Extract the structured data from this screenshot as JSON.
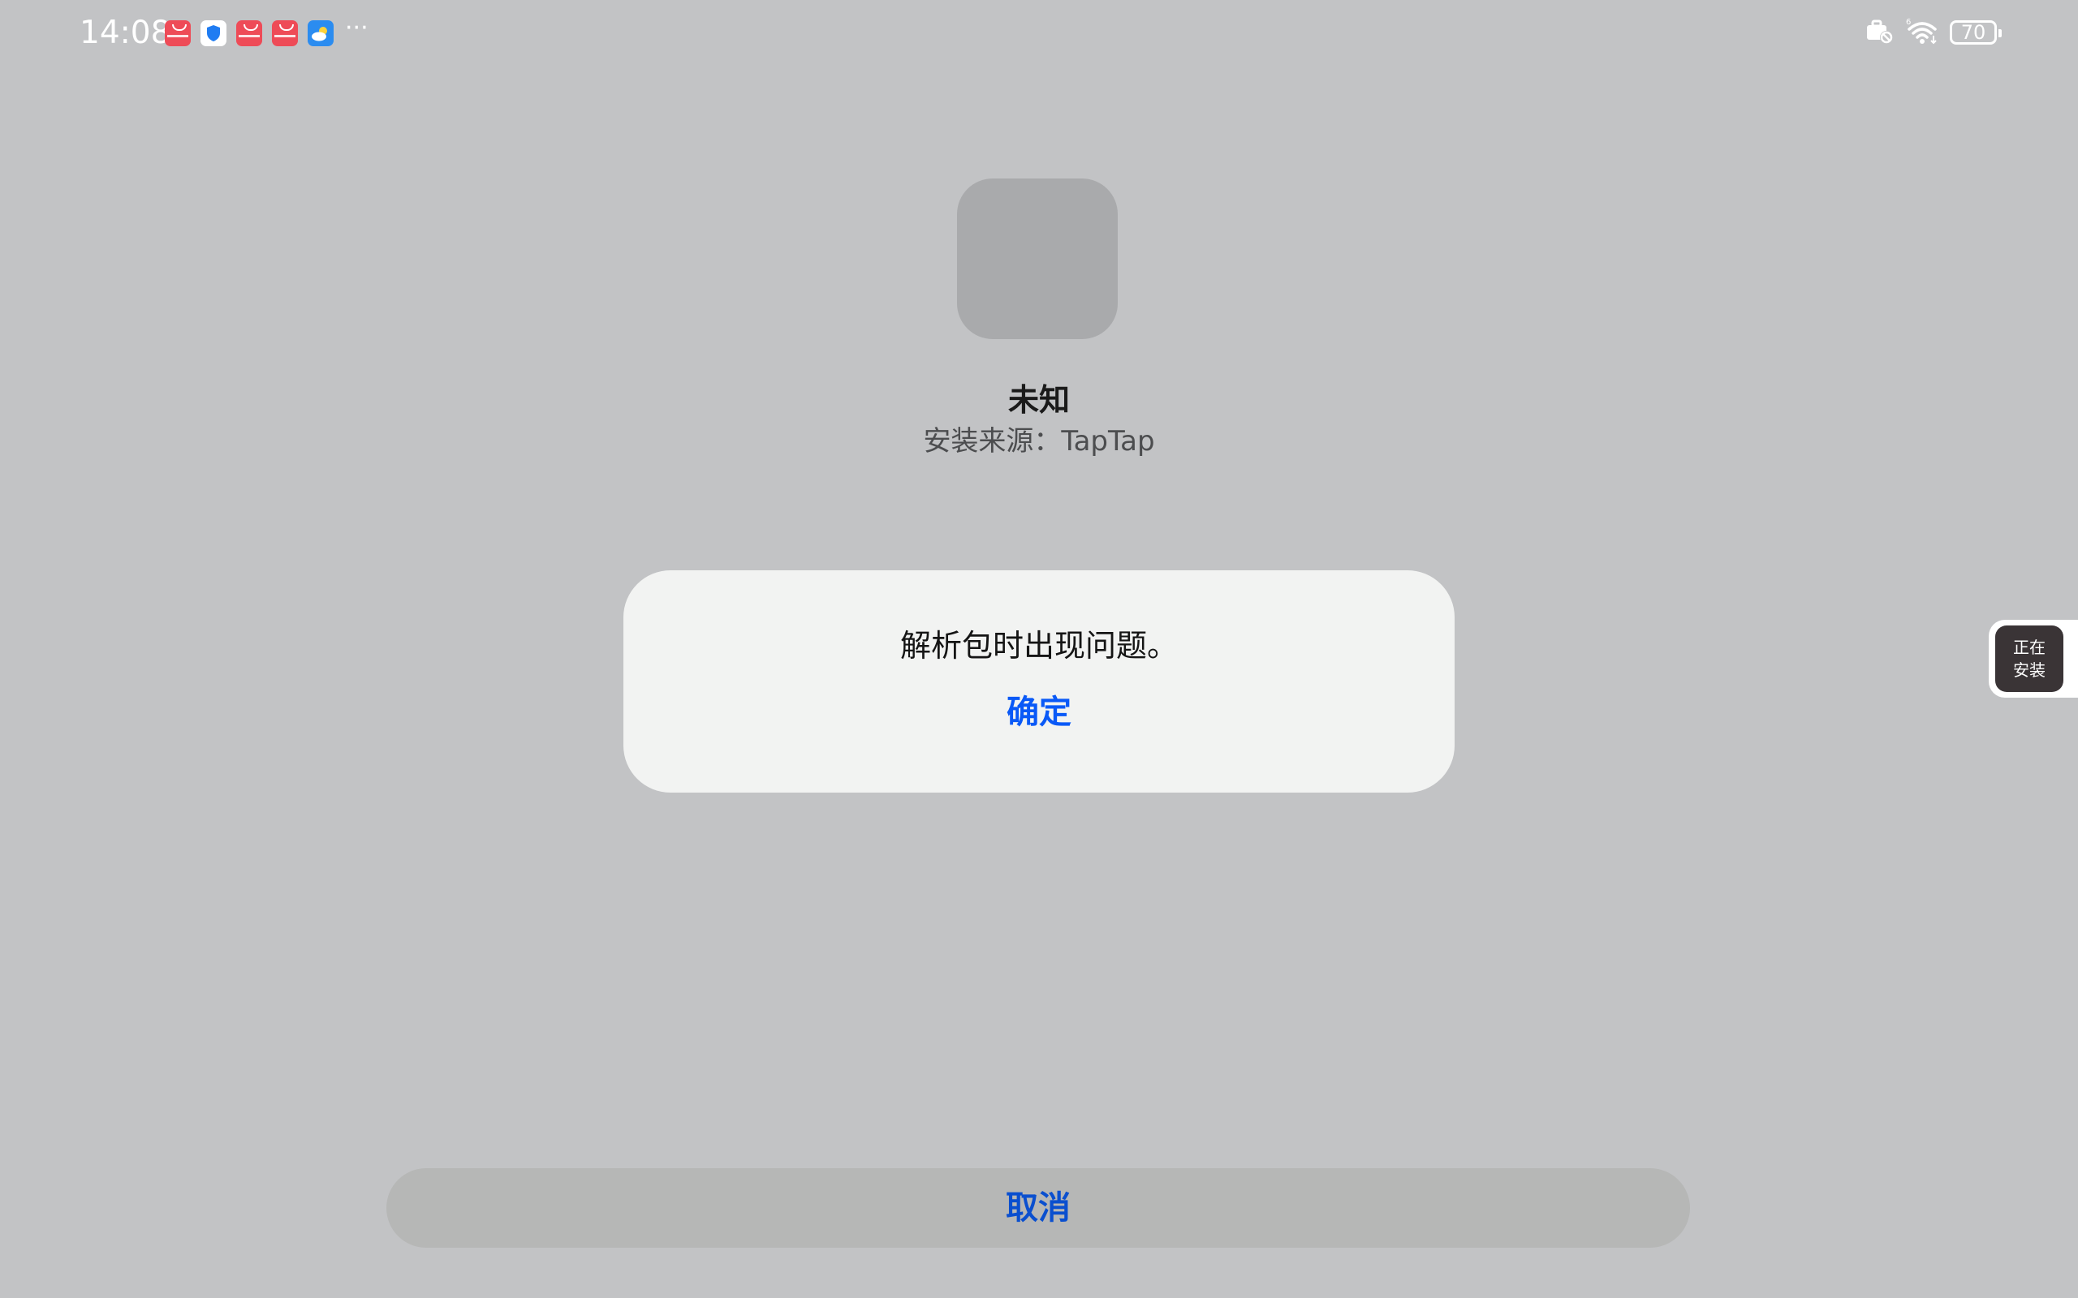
{
  "status_bar": {
    "time": "14:08",
    "notifications": [
      "appgallery-icon",
      "security-shield-icon",
      "appgallery-icon",
      "appgallery-icon",
      "weather-icon"
    ],
    "overflow": "···",
    "battery_level": "70",
    "signal_label": "6"
  },
  "app": {
    "name": "未知",
    "install_source": "安装来源：TapTap"
  },
  "dialog": {
    "message": "解析包时出现问题。",
    "ok_label": "确定"
  },
  "float_bubble": {
    "line1": "正在",
    "line2": "安装"
  },
  "cancel_label": "取消",
  "colors": {
    "background": "#c2c3c5",
    "dialog_bg": "#f2f3f2",
    "accent": "#0a59f7",
    "appgallery": "#ee4b57"
  }
}
